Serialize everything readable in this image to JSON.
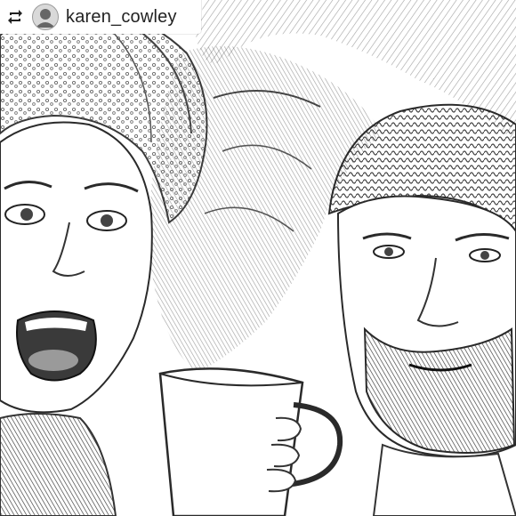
{
  "repost": {
    "icon": "repost-icon",
    "username": "karen_cowley"
  },
  "photo": {
    "style": "pencil-sketch",
    "subjects": [
      "woman-with-towel-on-head",
      "bearded-man-in-beanie"
    ],
    "prop": "mug"
  },
  "colors": {
    "ink": "#2a2a2a",
    "paper": "#ffffff",
    "shade": "#8c8c8c"
  }
}
